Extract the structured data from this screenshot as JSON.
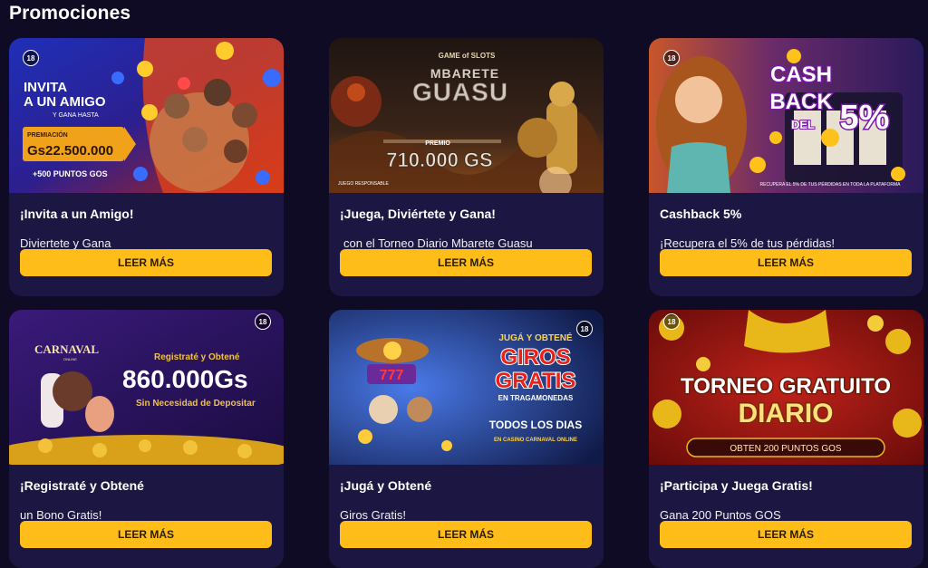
{
  "page": {
    "title": "Promociones"
  },
  "cta_label": "LEER MÁS",
  "age_badge": "18",
  "cards": [
    {
      "title": "¡Invita a un Amigo!",
      "subtitle": "Diviertete y Gana",
      "banner": {
        "line1": "INVITA",
        "line2": "A UN AMIGO",
        "line3": "Y GANA HASTA",
        "prize_label": "PREMIACIÓN",
        "prize_value": "Gs22.500.000",
        "extra": "+500 PUNTOS GOS"
      }
    },
    {
      "title": "¡Juega, Diviértete y Gana!",
      "subtitle": "con el  Torneo Diario Mbarete Guasu",
      "banner": {
        "logo": "GAME of SLOTS",
        "line1": "MBARETE",
        "line2": "GUASU",
        "prize_label": "PREMIO",
        "prize_value": "710.000 GS",
        "footer": "JUEGO RESPONSABLE"
      }
    },
    {
      "title": "Cashback 5%",
      "subtitle": "¡Recupera el 5% de tus pérdidas!",
      "banner": {
        "line1": "CASH",
        "line2": "BACK",
        "line3": "DEL",
        "value": "5%",
        "footer": "RECUPERA EL 5% DE TUS PÉRDIDAS EN TODA LA PLATAFORMA"
      }
    },
    {
      "title": "¡Registraté y Obtené",
      "subtitle": "un Bono Gratis!",
      "banner": {
        "brand": "CARNAVAL",
        "brand_sub": "ONLINE",
        "line1": "Registraté y Obtené",
        "value": "860.000Gs",
        "line2": "Sin Necesidad de Depositar"
      }
    },
    {
      "title": "¡Jugá y Obtené",
      "subtitle": "Giros Gratis!",
      "banner": {
        "line1": "JUGÁ Y OBTENÉ",
        "line2": "GIROS",
        "line3": "GRATIS",
        "line4": "EN TRAGAMONEDAS",
        "line5": "TODOS LOS DIAS",
        "line6": "EN CASINO CARNAVAL ONLINE",
        "reels": "777"
      }
    },
    {
      "title": "¡Participa y Juega Gratis!",
      "subtitle": "Gana 200 Puntos GOS",
      "banner": {
        "line1": "TORNEO GRATUITO",
        "line2": "DIARIO",
        "footer": "OBTEN 200 PUNTOS GOS"
      }
    }
  ]
}
